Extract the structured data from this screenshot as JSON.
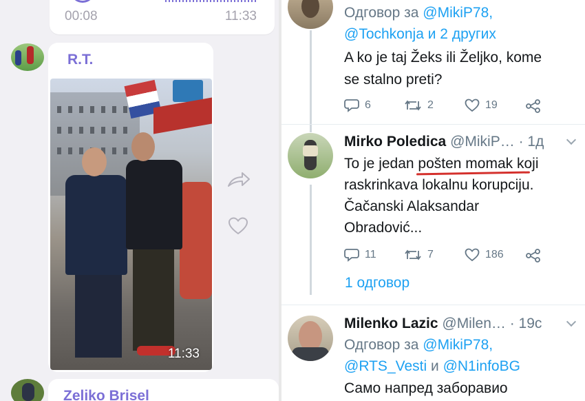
{
  "chat": {
    "voice_message": {
      "duration": "00:08",
      "time": "11:33"
    },
    "photo_message": {
      "sender": "R.T.",
      "time": "11:33"
    },
    "next_message": {
      "sender": "Zeliko Brisel"
    }
  },
  "twitter": {
    "tweet1": {
      "reply_prefix": "Одговор за",
      "mention1": "@MikiP78,",
      "mention2": "@Tochkonja",
      "reply_suffix": "и 2 других",
      "text_line1": "A ko je taj Žeks ili Željko, kome",
      "text_line2": "se stalno preti?",
      "replies": "6",
      "retweets": "2",
      "likes": "19"
    },
    "tweet2": {
      "name": "Mirko Poledica",
      "handle": "@MikiP…",
      "time": "· 1д",
      "text_line1": "To je jedan pošten momak koji",
      "text_line2": "raskrinkava lokalnu korupciju.",
      "text_line3": "Čačanski Alaksandar",
      "text_line4": "Obradović...",
      "replies": "11",
      "retweets": "7",
      "likes": "186",
      "replies_link": "1 одговор"
    },
    "tweet3": {
      "name": "Milenko Lazic",
      "handle": "@Milen…",
      "time": "· 19с",
      "reply_prefix": "Одговор за",
      "mention1": "@MikiP78,",
      "mention2": "@RTS_Vesti",
      "reply_mid": "и",
      "mention3": "@N1infoBG",
      "text_line1": "Само напред заборавио"
    }
  },
  "colors": {
    "viber_accent": "#7b6fd6",
    "twitter_link": "#1da1f2",
    "annotation_red": "#d4302c"
  }
}
